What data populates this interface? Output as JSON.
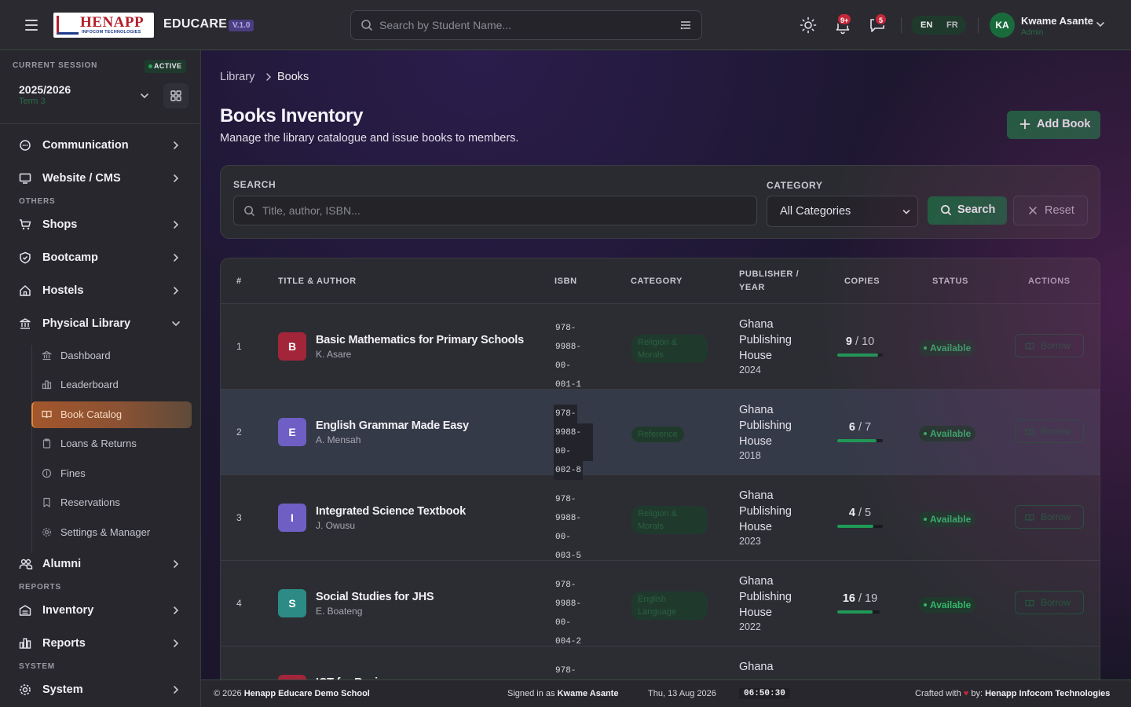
{
  "topbar": {
    "logo_text": "HENAPP",
    "logo_subtext": "INFOCOM TECHNOLOGIES",
    "brand": "EDUCARE",
    "version": "V.1.0",
    "search_placeholder": "Search by Student Name...",
    "notifications_badge": "9+",
    "messages_badge": "5",
    "lang_en": "EN",
    "lang_fr": "FR",
    "user_initials": "KA",
    "user_name": "Kwame Asante",
    "user_role": "Admin"
  },
  "session": {
    "label": "CURRENT SESSION",
    "status": "ACTIVE",
    "year": "2025/2026",
    "term": "Term 3"
  },
  "sidebar": {
    "items": [
      {
        "label": "Communication"
      },
      {
        "label": "Website / CMS"
      },
      {
        "label": "Shops"
      },
      {
        "label": "Bootcamp"
      },
      {
        "label": "Hostels"
      },
      {
        "label": "Physical Library"
      },
      {
        "label": "Alumni"
      },
      {
        "label": "Inventory"
      },
      {
        "label": "Reports"
      },
      {
        "label": "System"
      }
    ],
    "sections": {
      "others": "OTHERS",
      "reports": "REPORTS",
      "system": "SYSTEM"
    },
    "library_sub": [
      {
        "label": "Dashboard"
      },
      {
        "label": "Leaderboard"
      },
      {
        "label": "Book Catalog"
      },
      {
        "label": "Loans & Returns"
      },
      {
        "label": "Fines"
      },
      {
        "label": "Reservations"
      },
      {
        "label": "Settings & Manager"
      }
    ]
  },
  "main": {
    "breadcrumb": {
      "parent": "Library",
      "current": "Books"
    },
    "title": "Books Inventory",
    "subtitle": "Manage the library catalogue and issue books to members.",
    "add_button": "Add Book",
    "filter": {
      "search_label": "SEARCH",
      "search_placeholder": "Title, author, ISBN...",
      "category_label": "CATEGORY",
      "category_value": "All Categories",
      "search_button": "Search",
      "reset_button": "Reset"
    },
    "table": {
      "headers": {
        "num": "#",
        "title": "TITLE & AUTHOR",
        "isbn": "ISBN",
        "category": "CATEGORY",
        "publisher_l1": "PUBLISHER /",
        "publisher_l2": "YEAR",
        "copies": "COPIES",
        "status": "STATUS",
        "actions": "ACTIONS"
      },
      "rows": [
        {
          "num": "1",
          "initial": "B",
          "title": "Basic Mathematics for Primary Schools",
          "author": "K. Asare",
          "isbn1": "978-",
          "isbn2": "9988-00-",
          "isbn3": "001-1",
          "category_l1": "Religion &",
          "category_l2": "Morals",
          "pub1": "Ghana",
          "pub2": "Publishing",
          "pub3": "House",
          "year": "2024",
          "copies_avail": "9",
          "copies_total": "/ 10",
          "ratio": 0.9,
          "status": "Available",
          "action": "Borrow",
          "color": "#a3253a"
        },
        {
          "num": "2",
          "initial": "E",
          "title": "English Grammar Made Easy",
          "author": "A. Mensah",
          "isbn1": "978-",
          "isbn2": "9988-00-",
          "isbn3": "002-8",
          "category_l1": "Reference",
          "category_l2": "",
          "pub1": "Ghana",
          "pub2": "Publishing",
          "pub3": "House",
          "year": "2018",
          "copies_avail": "6",
          "copies_total": "/ 7",
          "ratio": 0.857,
          "status": "Available",
          "action": "Borrow",
          "color": "#6f5fc4"
        },
        {
          "num": "3",
          "initial": "I",
          "title": "Integrated Science Textbook",
          "author": "J. Owusu",
          "isbn1": "978-",
          "isbn2": "9988-00-",
          "isbn3": "003-5",
          "category_l1": "Religion &",
          "category_l2": "Morals",
          "pub1": "Ghana",
          "pub2": "Publishing",
          "pub3": "House",
          "year": "2023",
          "copies_avail": "4",
          "copies_total": "/ 5",
          "ratio": 0.8,
          "status": "Available",
          "action": "Borrow",
          "color": "#6f5fc4"
        },
        {
          "num": "4",
          "initial": "S",
          "title": "Social Studies for JHS",
          "author": "E. Boateng",
          "isbn1": "978-",
          "isbn2": "9988-00-",
          "isbn3": "004-2",
          "category_l1": "English",
          "category_l2": "Language",
          "pub1": "Ghana",
          "pub2": "Publishing",
          "pub3": "House",
          "year": "2022",
          "copies_avail": "16",
          "copies_total": "/ 19",
          "ratio": 0.842,
          "status": "Available",
          "action": "Borrow",
          "color": "#2c8b85"
        },
        {
          "num": "5",
          "initial": "I",
          "title": "ICT for Basic",
          "author": "",
          "isbn1": "978-",
          "isbn2": "",
          "isbn3": "",
          "category_l1": "",
          "category_l2": "",
          "pub1": "Ghana",
          "pub2": "",
          "pub3": "",
          "year": "",
          "copies_avail": "",
          "copies_total": "",
          "ratio": 0,
          "status": "",
          "action": "",
          "color": "#a3253a"
        }
      ]
    }
  },
  "footer": {
    "copyright": "© 2026",
    "school": "Henapp Educare Demo School",
    "signed_in_prefix": "Signed in as",
    "signed_in_user": "Kwame Asante",
    "date": "Thu, 13 Aug 2026",
    "time": "06:50:30",
    "crafted_prefix": "Crafted with",
    "crafted_by": "by:",
    "company": "Henapp Infocom Technologies"
  },
  "colors": {
    "accent_green": "#16653a",
    "badge_red": "#c3283a",
    "active_orange": "#a3562c",
    "status_green": "#37b56c"
  }
}
